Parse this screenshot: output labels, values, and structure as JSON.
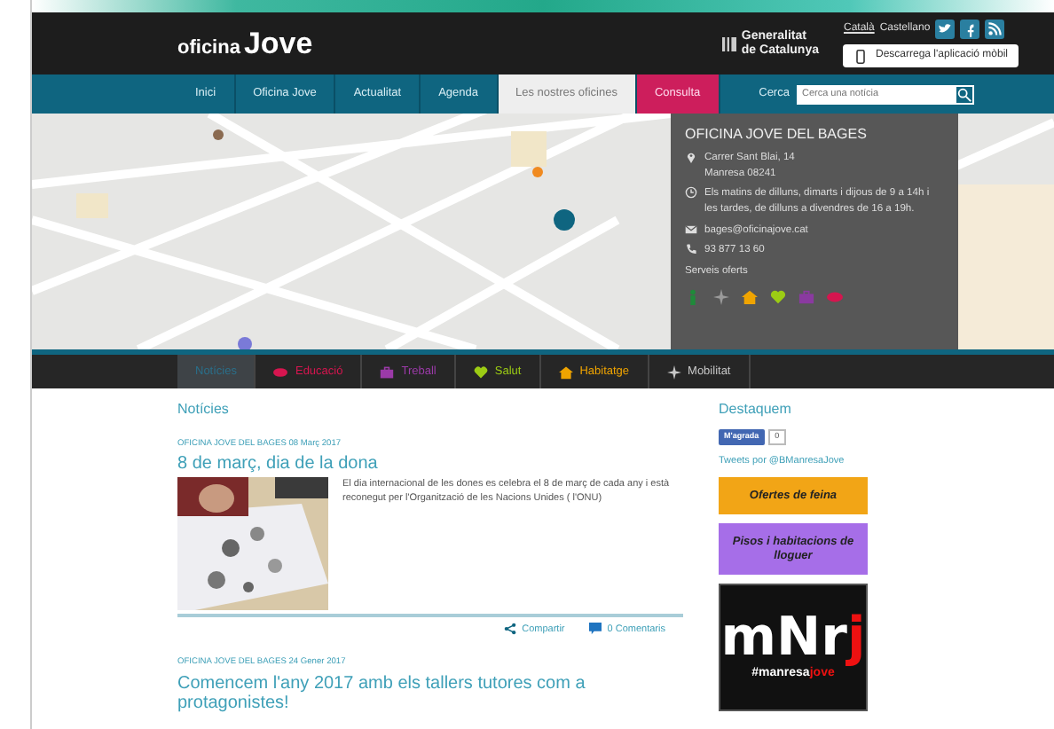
{
  "header": {
    "logo": [
      "oficina",
      "Jove"
    ],
    "government": [
      "Generalitat",
      "de Catalunya"
    ],
    "languages": [
      {
        "label": "Català",
        "selected": true
      },
      {
        "label": "Castellano",
        "selected": false
      }
    ],
    "social": [
      {
        "kind": "twitter"
      },
      {
        "kind": "facebook"
      },
      {
        "kind": "rss"
      }
    ],
    "app_button": "Descarrega l'aplicació mòbil"
  },
  "nav": {
    "items": [
      {
        "label": "Inici",
        "kind": "normal"
      },
      {
        "label": "Oficina Jove",
        "kind": "normal"
      },
      {
        "label": "Actualitat",
        "kind": "normal"
      },
      {
        "label": "Agenda",
        "kind": "normal"
      },
      {
        "label": "Les nostres oficines",
        "kind": "current"
      },
      {
        "label": "Consulta",
        "kind": "highlight"
      }
    ],
    "search_label": "Cerca",
    "search": {
      "placeholder": "Cerca una notícia"
    }
  },
  "office": {
    "title": "OFICINA JOVE DEL BAGES",
    "address": [
      "Carrer Sant Blai, 14",
      "Manresa 08241"
    ],
    "hours": "Els matins de dilluns, dimarts i dijous de 9 a 14h i les tardes, de dilluns a divendres de 16 a 19h.",
    "email": "bages@oficinajove.cat",
    "phone": "93 877 13 60",
    "services_label": "Serveis oferts",
    "services": [
      {
        "kind": "person",
        "color": "#1f8a3a"
      },
      {
        "kind": "plane",
        "color": "#9a9a9a"
      },
      {
        "kind": "house",
        "color": "#f0a400"
      },
      {
        "kind": "heart",
        "color": "#9ccc14"
      },
      {
        "kind": "case",
        "color": "#8a3aa0"
      },
      {
        "kind": "lips",
        "color": "#d6154f"
      }
    ]
  },
  "tabs": [
    {
      "label": "Notícies",
      "kind": "none",
      "selected": true
    },
    {
      "label": "Educació",
      "kind": "lips",
      "color": "#d6154f",
      "selected": false
    },
    {
      "label": "Treball",
      "kind": "case",
      "color": "#9b3aa8",
      "selected": false
    },
    {
      "label": "Salut",
      "kind": "heart",
      "color": "#9ccc14",
      "selected": false
    },
    {
      "label": "Habitatge",
      "kind": "house",
      "color": "#f0a400",
      "selected": false
    },
    {
      "label": "Mobilitat",
      "kind": "plane",
      "color": "#c8c8c8",
      "selected": false
    }
  ],
  "news": {
    "heading": "Notícies",
    "items": [
      {
        "source": "OFICINA JOVE DEL BAGES",
        "date": "08 Març 2017",
        "title": "8 de març, dia de la dona",
        "summary": "El dia internacional de les dones es celebra el 8 de març de cada any i està reconegut per l'Organització de les Nacions Unides ( l'ONU)",
        "share": "Compartir",
        "comments": "0 Comentaris"
      },
      {
        "source": "OFICINA JOVE DEL BAGES",
        "date": "24 Gener 2017",
        "title": "Comencem l'any 2017 amb els tallers tutores com a protagonistes!"
      }
    ]
  },
  "sidebar": {
    "heading": "Destaquem",
    "like_button": "M'agrada",
    "like_count": "0",
    "tweets_link": "Tweets por @BManresaJove",
    "banners": [
      {
        "label": "Ofertes de feina",
        "color": "#f2a516"
      },
      {
        "label": "Pisos i habitacions de lloguer",
        "color": "#a66ee8"
      }
    ],
    "promo": {
      "letters": [
        "mN",
        "r",
        "j"
      ],
      "hashtag": [
        "#manresa",
        "jove"
      ]
    }
  }
}
